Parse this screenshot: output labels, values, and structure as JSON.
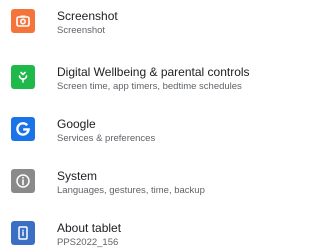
{
  "settings": {
    "items": [
      {
        "title": "Screenshot",
        "subtitle": "Screenshot",
        "icon": "screenshot-icon",
        "color": "#f4743b"
      },
      {
        "title": "Digital Wellbeing & parental controls",
        "subtitle": "Screen time, app timers, bedtime schedules",
        "icon": "wellbeing-icon",
        "color": "#1fb84a"
      },
      {
        "title": "Google",
        "subtitle": "Services & preferences",
        "icon": "google-icon",
        "color": "#1a73e8"
      },
      {
        "title": "System",
        "subtitle": "Languages, gestures, time, backup",
        "icon": "info-icon",
        "color": "#8a8a8a"
      },
      {
        "title": "About tablet",
        "subtitle": "PPS2022_156",
        "icon": "tablet-icon",
        "color": "#3b6fc4"
      }
    ]
  }
}
